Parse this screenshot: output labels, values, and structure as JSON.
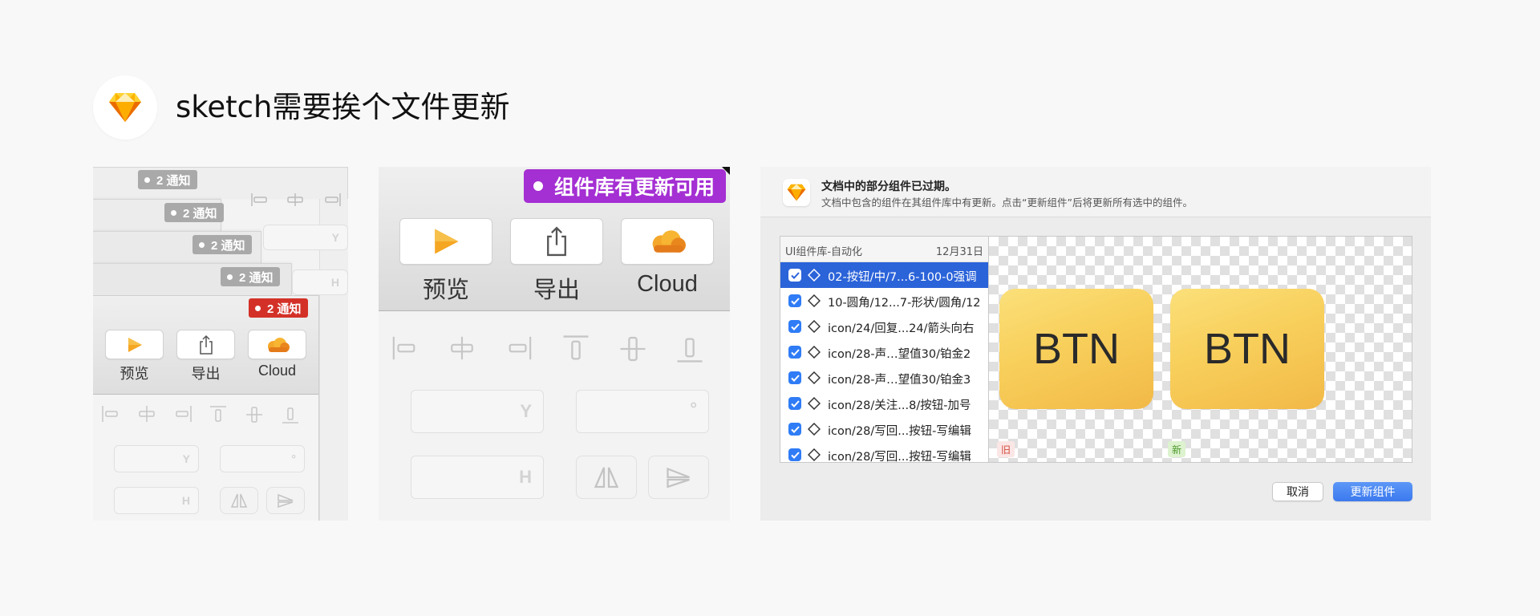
{
  "header": {
    "title": "sketch需要挨个文件更新",
    "logo_icon": "sketch-diamond-icon"
  },
  "panel_stack": {
    "notification_badges": [
      {
        "text": "2 通知",
        "color": "#a9a9a9"
      },
      {
        "text": "2 通知",
        "color": "#a9a9a9"
      },
      {
        "text": "2 通知",
        "color": "#a9a9a9"
      },
      {
        "text": "2 通知",
        "color": "#a9a9a9"
      },
      {
        "text": "2 通知",
        "color": "#d33128"
      }
    ],
    "toolbar": {
      "preview_label": "预览",
      "export_label": "导出",
      "cloud_label": "Cloud"
    },
    "field_y": "Y",
    "field_h": "H",
    "field_degree": "°"
  },
  "panel_zoom": {
    "badge_text": "组件库有更新可用",
    "badge_color": "#a42fd3",
    "toolbar": {
      "preview_label": "预览",
      "export_label": "导出",
      "cloud_label": "Cloud"
    },
    "field_y": "Y",
    "field_h": "H",
    "field_degree": "°"
  },
  "dialog": {
    "title": "文档中的部分组件已过期。",
    "description": "文档中包含的组件在其组件库中有更新。点击“更新组件”后将更新所有选中的组件。",
    "list_header": {
      "name": "UI组件库-自动化",
      "date": "12月31日"
    },
    "items": [
      {
        "label": "02-按钮/中/7...6-100-0强调",
        "checked": true,
        "selected": true
      },
      {
        "label": "10-圆角/12...7-形状/圆角/12",
        "checked": true,
        "selected": false
      },
      {
        "label": "icon/24/回复...24/箭头向右",
        "checked": true,
        "selected": false
      },
      {
        "label": "icon/28-声…望值30/铂金2",
        "checked": true,
        "selected": false
      },
      {
        "label": "icon/28-声…望值30/铂金3",
        "checked": true,
        "selected": false
      },
      {
        "label": "icon/28/关注...8/按钮-加号",
        "checked": true,
        "selected": false
      },
      {
        "label": "icon/28/写回...按钮-写编辑",
        "checked": true,
        "selected": false
      },
      {
        "label": "icon/28/写回...按钮-写编辑",
        "checked": true,
        "selected": false
      }
    ],
    "preview": {
      "old_button_text": "BTN",
      "new_button_text": "BTN",
      "old_tag": "旧",
      "new_tag": "新"
    },
    "cancel_label": "取消",
    "update_label": "更新组件",
    "accent_color": "#3b79ee"
  }
}
